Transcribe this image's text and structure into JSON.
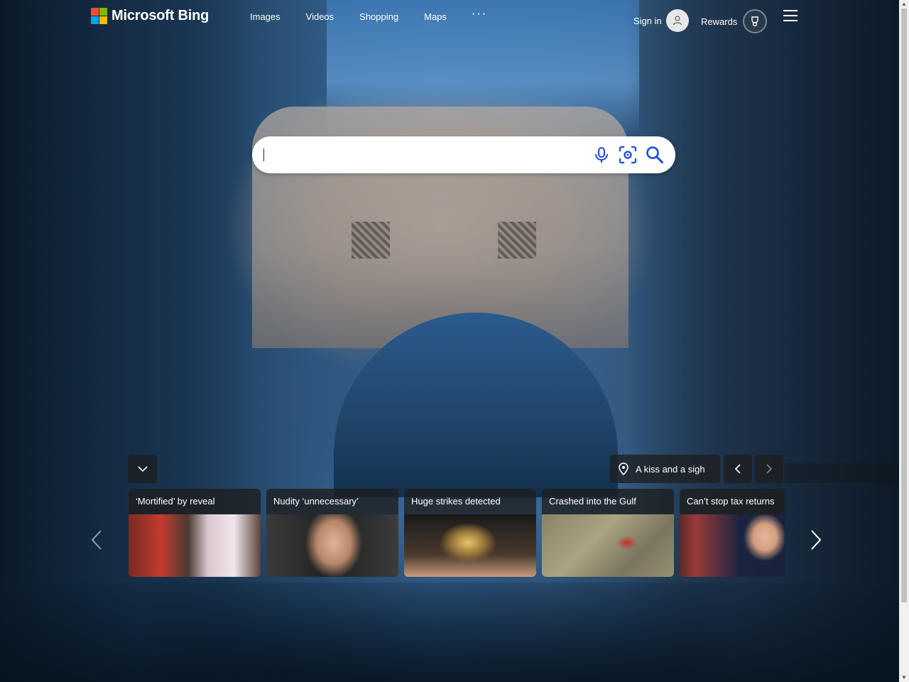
{
  "header": {
    "logo_text": "Microsoft Bing",
    "nav": [
      "Images",
      "Videos",
      "Shopping",
      "Maps",
      "···"
    ],
    "signin_label": "Sign in",
    "rewards_label": "Rewards"
  },
  "search": {
    "value": "",
    "icons": [
      "microphone-icon",
      "visual-search-icon",
      "search-icon"
    ]
  },
  "image_info": {
    "location_label": "A kiss and a sigh"
  },
  "news": [
    {
      "title": "‘Mortified’ by reveal"
    },
    {
      "title": "Nudity ‘unnecessary’"
    },
    {
      "title": "Huge strikes detected"
    },
    {
      "title": "Crashed into the Gulf"
    },
    {
      "title": "Can’t stop tax returns"
    }
  ],
  "colors": {
    "logo_red": "#f25022",
    "logo_green": "#7fba00",
    "logo_blue": "#00a4ef",
    "logo_yellow": "#ffb900",
    "search_icon": "#174ae4"
  }
}
